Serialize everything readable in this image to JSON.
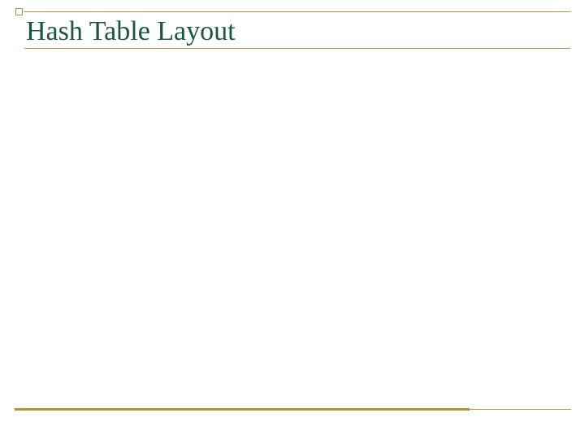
{
  "slide": {
    "title": "Hash Table Layout"
  }
}
